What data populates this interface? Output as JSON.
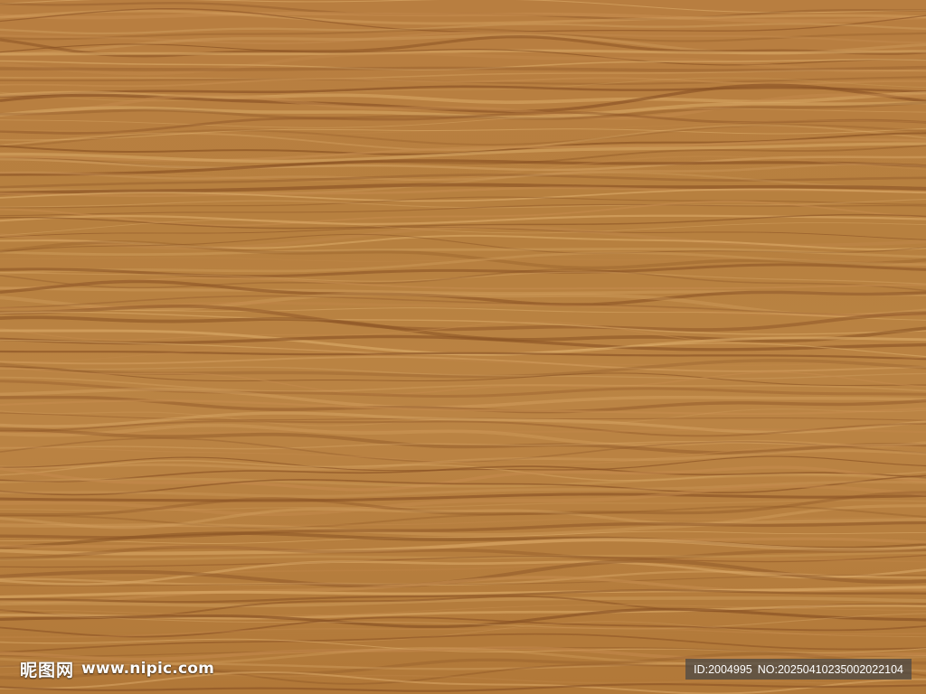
{
  "image": {
    "description_colors": {
      "base": "#b37a3e",
      "light_grain": "#d9a866",
      "dark_grain": "#8a5224",
      "mid_grain": "#c48a4c"
    }
  },
  "watermark": {
    "brand": "昵图网",
    "url": "www.nipic.com",
    "id_text": "ID:2004995",
    "no_text": "NO:20250410235002022104"
  }
}
